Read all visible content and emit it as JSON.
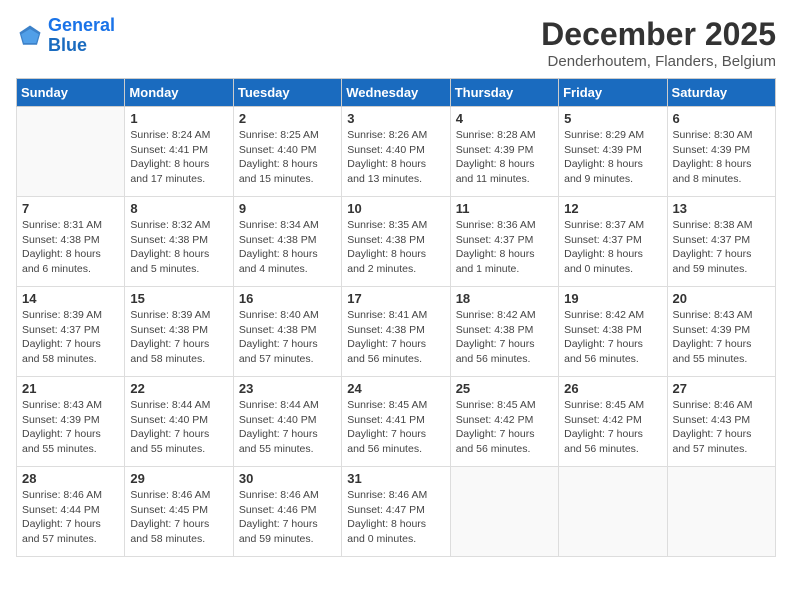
{
  "logo": {
    "line1": "General",
    "line2": "Blue"
  },
  "header": {
    "month": "December 2025",
    "location": "Denderhoutem, Flanders, Belgium"
  },
  "weekdays": [
    "Sunday",
    "Monday",
    "Tuesday",
    "Wednesday",
    "Thursday",
    "Friday",
    "Saturday"
  ],
  "weeks": [
    [
      {
        "day": "",
        "info": ""
      },
      {
        "day": "1",
        "info": "Sunrise: 8:24 AM\nSunset: 4:41 PM\nDaylight: 8 hours\nand 17 minutes."
      },
      {
        "day": "2",
        "info": "Sunrise: 8:25 AM\nSunset: 4:40 PM\nDaylight: 8 hours\nand 15 minutes."
      },
      {
        "day": "3",
        "info": "Sunrise: 8:26 AM\nSunset: 4:40 PM\nDaylight: 8 hours\nand 13 minutes."
      },
      {
        "day": "4",
        "info": "Sunrise: 8:28 AM\nSunset: 4:39 PM\nDaylight: 8 hours\nand 11 minutes."
      },
      {
        "day": "5",
        "info": "Sunrise: 8:29 AM\nSunset: 4:39 PM\nDaylight: 8 hours\nand 9 minutes."
      },
      {
        "day": "6",
        "info": "Sunrise: 8:30 AM\nSunset: 4:39 PM\nDaylight: 8 hours\nand 8 minutes."
      }
    ],
    [
      {
        "day": "7",
        "info": "Sunrise: 8:31 AM\nSunset: 4:38 PM\nDaylight: 8 hours\nand 6 minutes."
      },
      {
        "day": "8",
        "info": "Sunrise: 8:32 AM\nSunset: 4:38 PM\nDaylight: 8 hours\nand 5 minutes."
      },
      {
        "day": "9",
        "info": "Sunrise: 8:34 AM\nSunset: 4:38 PM\nDaylight: 8 hours\nand 4 minutes."
      },
      {
        "day": "10",
        "info": "Sunrise: 8:35 AM\nSunset: 4:38 PM\nDaylight: 8 hours\nand 2 minutes."
      },
      {
        "day": "11",
        "info": "Sunrise: 8:36 AM\nSunset: 4:37 PM\nDaylight: 8 hours\nand 1 minute."
      },
      {
        "day": "12",
        "info": "Sunrise: 8:37 AM\nSunset: 4:37 PM\nDaylight: 8 hours\nand 0 minutes."
      },
      {
        "day": "13",
        "info": "Sunrise: 8:38 AM\nSunset: 4:37 PM\nDaylight: 7 hours\nand 59 minutes."
      }
    ],
    [
      {
        "day": "14",
        "info": "Sunrise: 8:39 AM\nSunset: 4:37 PM\nDaylight: 7 hours\nand 58 minutes."
      },
      {
        "day": "15",
        "info": "Sunrise: 8:39 AM\nSunset: 4:38 PM\nDaylight: 7 hours\nand 58 minutes."
      },
      {
        "day": "16",
        "info": "Sunrise: 8:40 AM\nSunset: 4:38 PM\nDaylight: 7 hours\nand 57 minutes."
      },
      {
        "day": "17",
        "info": "Sunrise: 8:41 AM\nSunset: 4:38 PM\nDaylight: 7 hours\nand 56 minutes."
      },
      {
        "day": "18",
        "info": "Sunrise: 8:42 AM\nSunset: 4:38 PM\nDaylight: 7 hours\nand 56 minutes."
      },
      {
        "day": "19",
        "info": "Sunrise: 8:42 AM\nSunset: 4:38 PM\nDaylight: 7 hours\nand 56 minutes."
      },
      {
        "day": "20",
        "info": "Sunrise: 8:43 AM\nSunset: 4:39 PM\nDaylight: 7 hours\nand 55 minutes."
      }
    ],
    [
      {
        "day": "21",
        "info": "Sunrise: 8:43 AM\nSunset: 4:39 PM\nDaylight: 7 hours\nand 55 minutes."
      },
      {
        "day": "22",
        "info": "Sunrise: 8:44 AM\nSunset: 4:40 PM\nDaylight: 7 hours\nand 55 minutes."
      },
      {
        "day": "23",
        "info": "Sunrise: 8:44 AM\nSunset: 4:40 PM\nDaylight: 7 hours\nand 55 minutes."
      },
      {
        "day": "24",
        "info": "Sunrise: 8:45 AM\nSunset: 4:41 PM\nDaylight: 7 hours\nand 56 minutes."
      },
      {
        "day": "25",
        "info": "Sunrise: 8:45 AM\nSunset: 4:42 PM\nDaylight: 7 hours\nand 56 minutes."
      },
      {
        "day": "26",
        "info": "Sunrise: 8:45 AM\nSunset: 4:42 PM\nDaylight: 7 hours\nand 56 minutes."
      },
      {
        "day": "27",
        "info": "Sunrise: 8:46 AM\nSunset: 4:43 PM\nDaylight: 7 hours\nand 57 minutes."
      }
    ],
    [
      {
        "day": "28",
        "info": "Sunrise: 8:46 AM\nSunset: 4:44 PM\nDaylight: 7 hours\nand 57 minutes."
      },
      {
        "day": "29",
        "info": "Sunrise: 8:46 AM\nSunset: 4:45 PM\nDaylight: 7 hours\nand 58 minutes."
      },
      {
        "day": "30",
        "info": "Sunrise: 8:46 AM\nSunset: 4:46 PM\nDaylight: 7 hours\nand 59 minutes."
      },
      {
        "day": "31",
        "info": "Sunrise: 8:46 AM\nSunset: 4:47 PM\nDaylight: 8 hours\nand 0 minutes."
      },
      {
        "day": "",
        "info": ""
      },
      {
        "day": "",
        "info": ""
      },
      {
        "day": "",
        "info": ""
      }
    ]
  ]
}
